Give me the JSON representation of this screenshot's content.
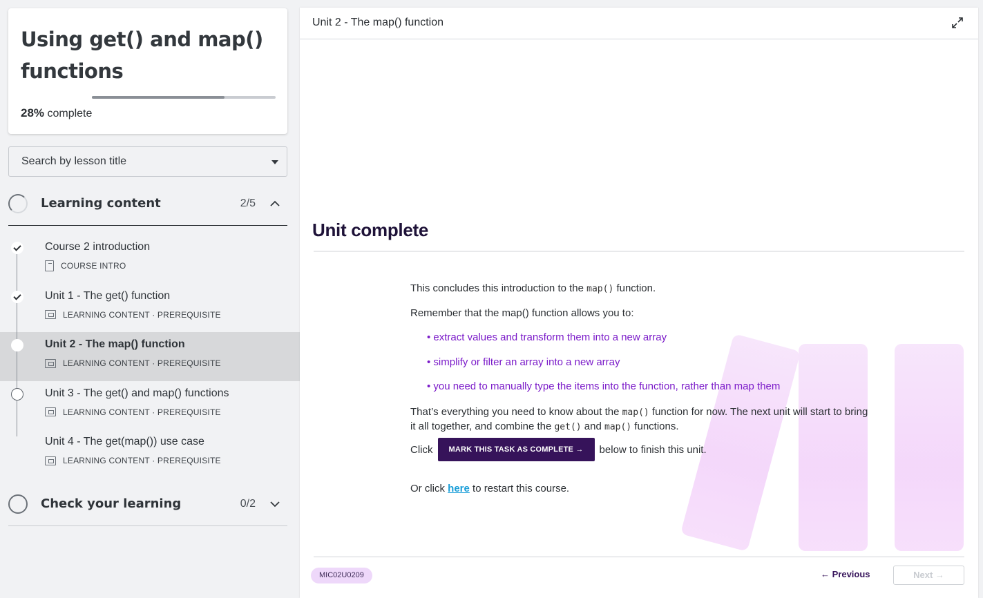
{
  "course": {
    "title": "Using get() and map() functions",
    "progress_percent": 28,
    "progress_value": "28%",
    "progress_suffix": " complete"
  },
  "search": {
    "placeholder": "Search by lesson title"
  },
  "sections": [
    {
      "title": "Learning content",
      "count": "2/5",
      "expanded": true
    },
    {
      "title": "Check your learning",
      "count": "0/2",
      "expanded": false
    }
  ],
  "lessons": [
    {
      "name": "Course 2 introduction",
      "meta": "COURSE INTRO",
      "status": "complete",
      "icon": "document-icon"
    },
    {
      "name": "Unit 1 - The get() function",
      "meta": "LEARNING CONTENT · PREREQUISITE",
      "status": "complete",
      "icon": "lesson-icon"
    },
    {
      "name": "Unit 2 - The map() function",
      "meta": "LEARNING CONTENT · PREREQUISITE",
      "status": "current",
      "icon": "lesson-icon"
    },
    {
      "name": "Unit 3 - The get() and map() functions",
      "meta": "LEARNING CONTENT · PREREQUISITE",
      "status": "incomplete",
      "icon": "lesson-icon"
    },
    {
      "name": "Unit 4 - The get(map()) use case",
      "meta": "LEARNING CONTENT · PREREQUISITE",
      "status": "incomplete",
      "icon": "lesson-icon"
    }
  ],
  "main": {
    "header_title": "Unit 2 - The map() function",
    "unit_title": "Unit complete",
    "intro_prefix": "This concludes this introduction to the ",
    "intro_code": "map()",
    "intro_suffix": " function.",
    "remember": "Remember that the map() function allows you to:",
    "bullets": [
      "extract values and transform them into a new array",
      "simplify or filter an array into a new array",
      "you need to manually type the items into the function, rather than map them"
    ],
    "summary_1": "That’s everything you need to know about the ",
    "summary_code_1": "map()",
    "summary_2": " function for now. The next unit will start to bring it all together, and combine the ",
    "summary_code_2": "get()",
    "summary_3": " and ",
    "summary_code_3": "map()",
    "summary_4": " functions.",
    "click_prefix": "Click",
    "mark_button": "MARK THIS TASK AS COMPLETE →",
    "click_suffix": "below to finish this unit.",
    "restart_prefix": "Or click ",
    "restart_link": "here",
    "restart_suffix": " to restart this course."
  },
  "footer": {
    "code": "MIC02U0209",
    "previous": "← Previous",
    "next": "Next →"
  },
  "colors": {
    "brand_dark": "#36135a",
    "accent_purple": "#7b1bc9",
    "link_blue": "#1a9ed8"
  }
}
